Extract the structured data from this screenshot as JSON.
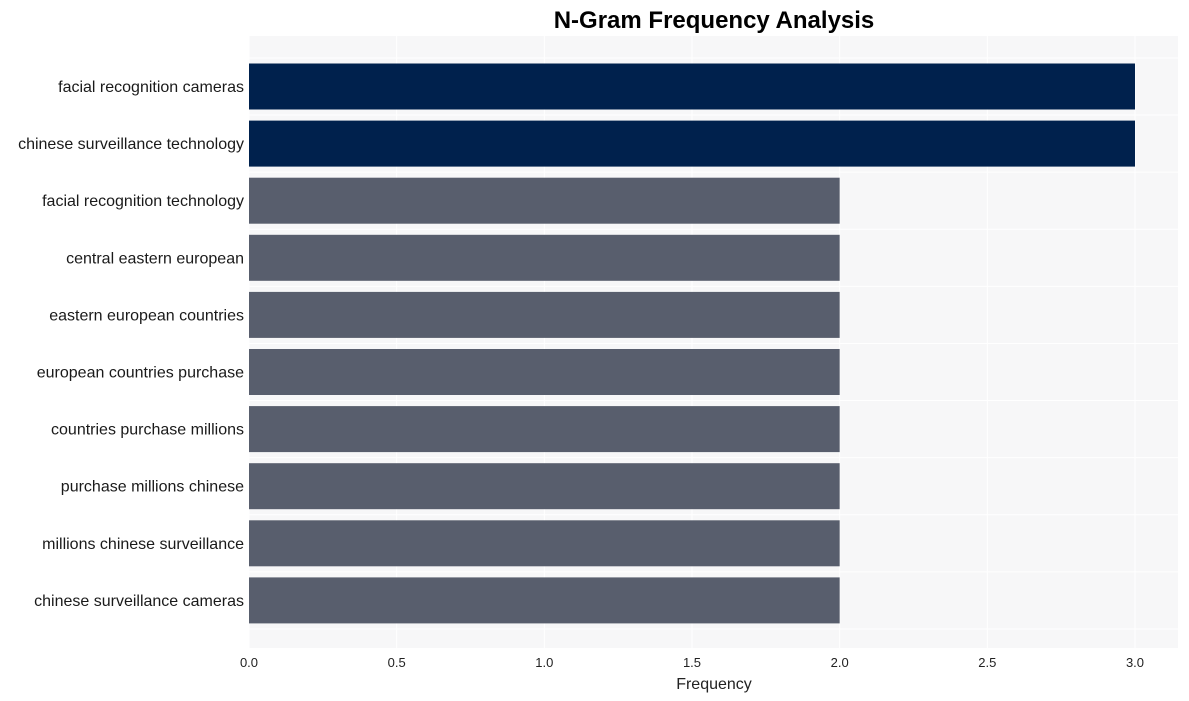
{
  "chart_data": {
    "type": "bar",
    "orientation": "horizontal",
    "title": "N-Gram Frequency Analysis",
    "xlabel": "Frequency",
    "ylabel": "",
    "xlim": [
      0,
      3.15
    ],
    "xticks": [
      0.0,
      0.5,
      1.0,
      1.5,
      2.0,
      2.5,
      3.0
    ],
    "xtick_labels": [
      "0.0",
      "0.5",
      "1.0",
      "1.5",
      "2.0",
      "2.5",
      "3.0"
    ],
    "grid": true,
    "legend": "none",
    "categories": [
      "facial recognition cameras",
      "chinese surveillance technology",
      "facial recognition technology",
      "central eastern european",
      "eastern european countries",
      "european countries purchase",
      "countries purchase millions",
      "purchase millions chinese",
      "millions chinese surveillance",
      "chinese surveillance cameras"
    ],
    "values": [
      3,
      3,
      2,
      2,
      2,
      2,
      2,
      2,
      2,
      2
    ],
    "colors": {
      "top": "#00214d",
      "other": "#585e6d",
      "plot_background": "#f7f7f8",
      "grid": "#ffffff"
    }
  }
}
